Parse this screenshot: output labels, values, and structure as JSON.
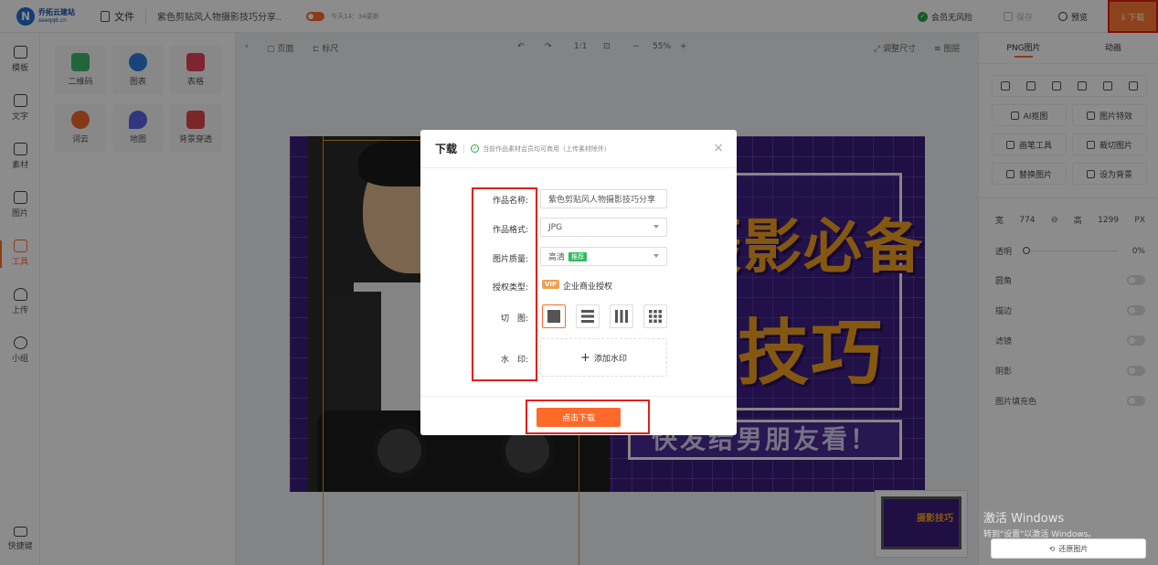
{
  "app": {
    "logo_mark": "N",
    "logo_name": "乔拓云建站",
    "logo_domain": "seeqq6.cn"
  },
  "topbar": {
    "file_label": "文件",
    "doc_title": "紫色剪贴风人物摄影技巧分享...",
    "save_status": "今天14：34更新",
    "member_label": "会员无风险",
    "save_label": "保存",
    "preview_label": "预览",
    "download_label": "下载"
  },
  "sidebar": {
    "items": [
      {
        "label": "模板"
      },
      {
        "label": "文字"
      },
      {
        "label": "素材"
      },
      {
        "label": "图片"
      },
      {
        "label": "工具"
      },
      {
        "label": "上传"
      },
      {
        "label": "小组"
      }
    ],
    "shortcuts_label": "快捷键"
  },
  "tools": {
    "items": [
      {
        "label": "二维码",
        "color": "#3cba6b"
      },
      {
        "label": "图表",
        "color": "#2f7de1"
      },
      {
        "label": "表格",
        "color": "#e8425a"
      },
      {
        "label": "词云",
        "color": "#f06a2a"
      },
      {
        "label": "地图",
        "color": "#5a63e6"
      },
      {
        "label": "背景穿透",
        "color": "#e04848"
      }
    ]
  },
  "canvas_toolbar": {
    "page_label": "页面",
    "ruler_label": "标尺",
    "ratio_label": "1:1",
    "zoom": "55%",
    "resize_label": "调整尺寸",
    "layers_label": "图层"
  },
  "poster": {
    "line1": "摄影必备",
    "line2": "技巧",
    "banner": "快发给男朋友看！"
  },
  "minimap": {
    "thumb_text": "摄影技巧"
  },
  "right_panel": {
    "tabs": [
      "PNG图片",
      "动画"
    ],
    "buttons": [
      "AI抠图",
      "图片特效",
      "画笔工具",
      "裁切图片",
      "替换图片",
      "设为背景"
    ],
    "width_label": "宽",
    "width_value": "774",
    "height_label": "高",
    "height_value": "1299",
    "unit": "PX",
    "opacity_label": "透明",
    "opacity_value": "0%",
    "toggles": [
      "圆角",
      "描边",
      "滤镜",
      "阴影",
      "图片填充色"
    ],
    "restore_label": "还原图片"
  },
  "activation": {
    "line1": "激活 Windows",
    "line2": "转到\"设置\"以激活 Windows。"
  },
  "dialog": {
    "title": "下载",
    "subtitle": "当前作品素材会员均可商用（上传素材除外）",
    "close": "×",
    "name_label": "作品名称:",
    "name_value": "紫色剪贴风人物摄影技巧分享",
    "format_label": "作品格式:",
    "format_value": "JPG",
    "quality_label": "图片质量:",
    "quality_value": "高清",
    "quality_badge": "推荐",
    "license_label": "授权类型:",
    "license_badge": "VIP",
    "license_value": "企业商业授权",
    "cut_label": "切　图:",
    "watermark_label": "水　印:",
    "watermark_add": "添加水印",
    "download_button": "点击下载"
  },
  "colors": {
    "accent": "#ff6a2a",
    "highlight_box": "#e0201a",
    "poster_bg": "#3a1d7a",
    "poster_text": "#f0a11f"
  }
}
